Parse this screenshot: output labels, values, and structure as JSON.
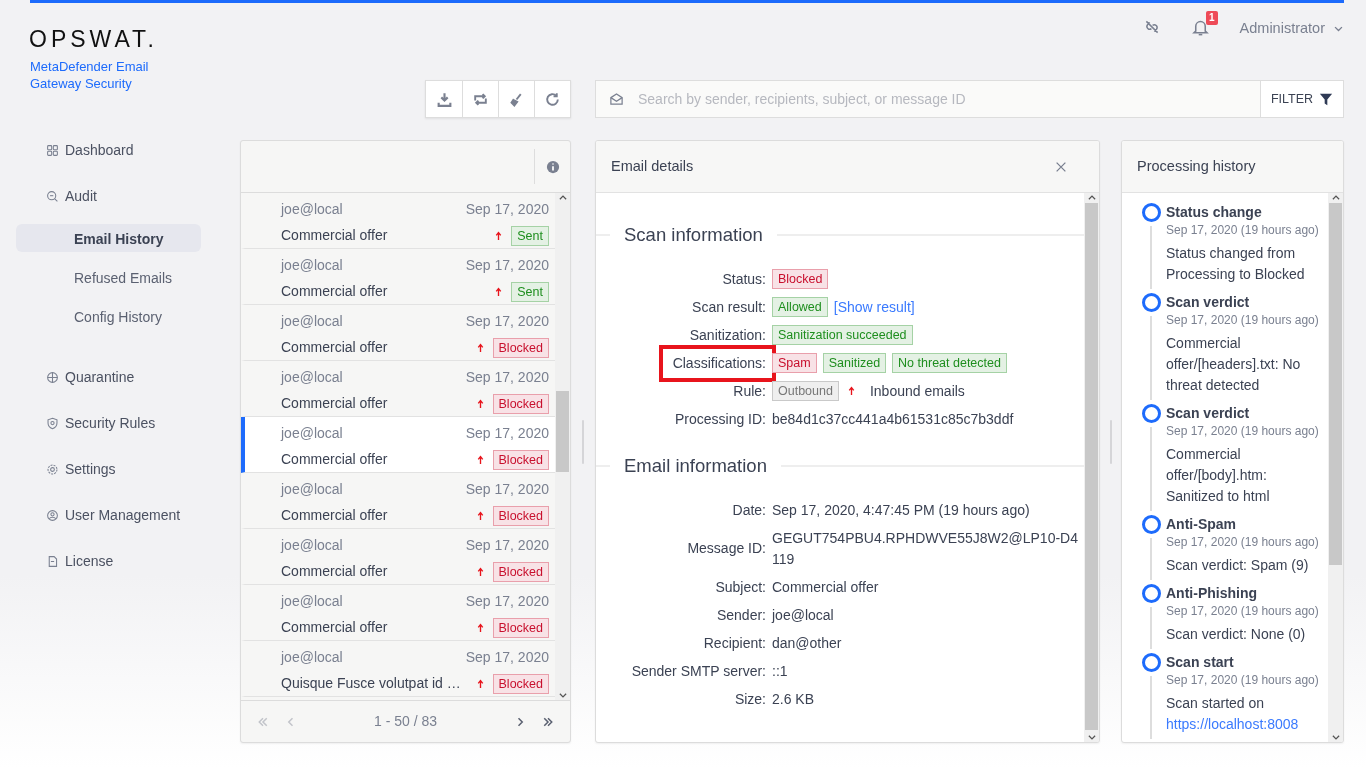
{
  "logo": {
    "wordmark": "OPSWAT.",
    "product": "MetaDefender Email Gateway Security"
  },
  "header": {
    "notification_count": "1",
    "user": "Administrator"
  },
  "sidebar": {
    "items": [
      {
        "label": "Dashboard",
        "selected": false
      },
      {
        "label": "Audit",
        "selected": false,
        "children": [
          {
            "label": "Email History",
            "selected": true
          },
          {
            "label": "Refused Emails",
            "selected": false
          },
          {
            "label": "Config History",
            "selected": false
          }
        ]
      },
      {
        "label": "Quarantine",
        "selected": false
      },
      {
        "label": "Security Rules",
        "selected": false
      },
      {
        "label": "Settings",
        "selected": false
      },
      {
        "label": "User Management",
        "selected": false
      },
      {
        "label": "License",
        "selected": false
      }
    ]
  },
  "search": {
    "placeholder": "Search by sender, recipients, subject, or message ID"
  },
  "filter_button": "FILTER",
  "email_list": {
    "rows": [
      {
        "sender": "joe@local",
        "subject": "Commercial offer",
        "date": "Sep 17, 2020",
        "status": "Sent",
        "color": "#1e8e1e",
        "selected": false
      },
      {
        "sender": "joe@local",
        "subject": "Commercial offer",
        "date": "Sep 17, 2020",
        "status": "Sent",
        "color": "#1e8e1e",
        "selected": false
      },
      {
        "sender": "joe@local",
        "subject": "Commercial offer",
        "date": "Sep 17, 2020",
        "status": "Blocked",
        "color": "#c8102e",
        "selected": false
      },
      {
        "sender": "joe@local",
        "subject": "Commercial offer",
        "date": "Sep 17, 2020",
        "status": "Blocked",
        "color": "#c8102e",
        "selected": false
      },
      {
        "sender": "joe@local",
        "subject": "Commercial offer",
        "date": "Sep 17, 2020",
        "status": "Blocked",
        "color": "#c8102e",
        "selected": true
      },
      {
        "sender": "joe@local",
        "subject": "Commercial offer",
        "date": "Sep 17, 2020",
        "status": "Blocked",
        "color": "#c8102e",
        "selected": false
      },
      {
        "sender": "joe@local",
        "subject": "Commercial offer",
        "date": "Sep 17, 2020",
        "status": "Blocked",
        "color": "#c8102e",
        "selected": false
      },
      {
        "sender": "joe@local",
        "subject": "Commercial offer",
        "date": "Sep 17, 2020",
        "status": "Blocked",
        "color": "#c8102e",
        "selected": false
      },
      {
        "sender": "joe@local",
        "subject": "Quisque Fusce volutpat id …",
        "date": "Sep 17, 2020",
        "status": "Blocked",
        "color": "#c8102e",
        "selected": false
      }
    ],
    "pagination": "1 - 50 / 83"
  },
  "email_details": {
    "title": "Email details",
    "sections": [
      {
        "heading": "Scan information",
        "fields": [
          {
            "label": "Status:",
            "highlighted": false,
            "values": [
              {
                "kind": "tag",
                "text": "Blocked",
                "color": "#c8102e"
              }
            ]
          },
          {
            "label": "Scan result:",
            "highlighted": false,
            "values": [
              {
                "kind": "tag",
                "text": "Allowed",
                "color": "#1e8e1e"
              },
              {
                "kind": "link",
                "text": "[Show result]"
              }
            ]
          },
          {
            "label": "Sanitization:",
            "highlighted": false,
            "values": [
              {
                "kind": "tag",
                "text": "Sanitization succeeded",
                "color": "#1e8e1e"
              }
            ]
          },
          {
            "label": "Classifications:",
            "highlighted": true,
            "values": [
              {
                "kind": "tag",
                "text": "Spam",
                "color": "#c8102e"
              },
              {
                "kind": "tag",
                "text": "Sanitized",
                "color": "#1e8e1e"
              },
              {
                "kind": "tag",
                "text": "No threat detected",
                "color": "#1e8e1e"
              }
            ]
          },
          {
            "label": "Rule:",
            "highlighted": false,
            "values": [
              {
                "kind": "tag",
                "text": "Outbound",
                "color": "#777777"
              },
              {
                "kind": "arrow"
              },
              {
                "kind": "text",
                "text": "Inbound emails"
              }
            ]
          },
          {
            "label": "Processing ID:",
            "highlighted": false,
            "values": [
              {
                "kind": "text",
                "text": "be84d1c37cc441a4b61531c85c7b3ddf"
              }
            ]
          }
        ]
      },
      {
        "heading": "Email information",
        "fields": [
          {
            "label": "Date:",
            "highlighted": false,
            "values": [
              {
                "kind": "text",
                "text": "Sep 17, 2020, 4:47:45 PM (19 hours ago)"
              }
            ]
          },
          {
            "label": "Message ID:",
            "highlighted": false,
            "values": [
              {
                "kind": "text",
                "text": "GEGUT754PBU4.RPHDWVE55J8W2@LP10-D4119"
              }
            ]
          },
          {
            "label": "Subject:",
            "highlighted": false,
            "values": [
              {
                "kind": "text",
                "text": "Commercial offer"
              }
            ]
          },
          {
            "label": "Sender:",
            "highlighted": false,
            "values": [
              {
                "kind": "text",
                "text": "joe@local"
              }
            ]
          },
          {
            "label": "Recipient:",
            "highlighted": false,
            "values": [
              {
                "kind": "text",
                "text": "dan@other"
              }
            ]
          },
          {
            "label": "Sender SMTP server:",
            "highlighted": false,
            "values": [
              {
                "kind": "text",
                "text": "::1"
              }
            ]
          },
          {
            "label": "Size:",
            "highlighted": false,
            "values": [
              {
                "kind": "text",
                "text": "2.6 KB"
              }
            ]
          }
        ]
      }
    ]
  },
  "processing_history": {
    "title": "Processing history",
    "events": [
      {
        "title": "Status change",
        "time": "Sep 17, 2020 (19 hours ago)",
        "description": "Status changed from Processing to Blocked"
      },
      {
        "title": "Scan verdict",
        "time": "Sep 17, 2020 (19 hours ago)",
        "description": "Commercial offer/[headers].txt: No threat detected"
      },
      {
        "title": "Scan verdict",
        "time": "Sep 17, 2020 (19 hours ago)",
        "description": "Commercial offer/[body].htm: Sanitized to html"
      },
      {
        "title": "Anti-Spam",
        "time": "Sep 17, 2020 (19 hours ago)",
        "description": "Scan verdict: Spam (9)"
      },
      {
        "title": "Anti-Phishing",
        "time": "Sep 17, 2020 (19 hours ago)",
        "description": "Scan verdict: None (0)"
      },
      {
        "title": "Scan start",
        "time": "Sep 17, 2020 (19 hours ago)",
        "description": "Scan started on",
        "link": "https://localhost:8008"
      }
    ]
  }
}
